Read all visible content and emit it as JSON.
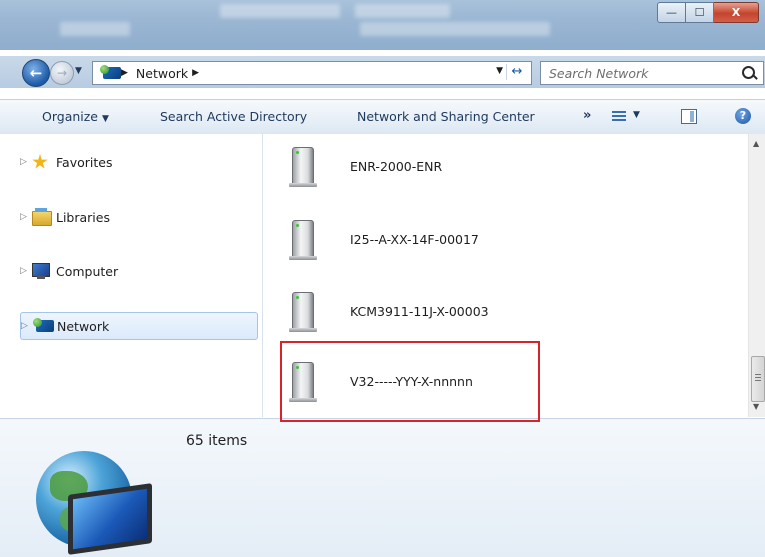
{
  "window": {
    "controls": {
      "minimize": "—",
      "maximize": "☐",
      "close": "X"
    }
  },
  "address": {
    "back_icon": "back-arrow-icon",
    "forward_icon": "forward-arrow-icon",
    "location": "Network",
    "separator": "▶",
    "refresh_icon": "refresh-icon"
  },
  "search": {
    "placeholder": "Search Network"
  },
  "toolbar": {
    "organize": "Organize",
    "search_ad": "Search Active Directory",
    "network_sharing": "Network and Sharing Center",
    "overflow": "»"
  },
  "nav": {
    "items": [
      {
        "label": "Favorites",
        "icon": "star-icon"
      },
      {
        "label": "Libraries",
        "icon": "libraries-icon"
      },
      {
        "label": "Computer",
        "icon": "computer-icon"
      },
      {
        "label": "Network",
        "icon": "network-icon",
        "selected": true
      }
    ]
  },
  "files": [
    {
      "name": "ENR-2000-ENR",
      "icon": "server-icon"
    },
    {
      "name": "I25--A-XX-14F-00017",
      "icon": "server-icon"
    },
    {
      "name": "KCM3911-11J-X-00003",
      "icon": "server-icon"
    },
    {
      "name": "V32-----YYY-X-nnnnn",
      "icon": "server-icon",
      "highlighted": true
    }
  ],
  "details": {
    "count": "65 items",
    "icon": "network-globe-icon"
  },
  "colors": {
    "highlight_border": "#d9232b",
    "selection_bg": "#dbeafb"
  }
}
